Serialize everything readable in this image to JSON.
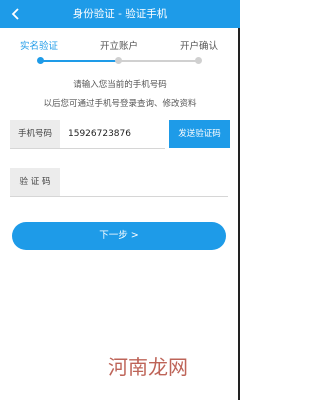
{
  "titlebar": {
    "title": "身份验证 - 验证手机",
    "back_icon": "chevron-left-icon"
  },
  "steps": {
    "items": [
      {
        "label": "实名验证",
        "state": "active"
      },
      {
        "label": "开立账户",
        "state": "pending"
      },
      {
        "label": "开户确认",
        "state": "pending"
      }
    ]
  },
  "intro": {
    "line1": "请输入您当前的手机号码",
    "line2": "以后您可通过手机号登录查询、修改资料"
  },
  "phone": {
    "label": "手机号码",
    "value": "15926723876"
  },
  "sms_button": "发送验证码",
  "code": {
    "label": "验 证 码",
    "value": ""
  },
  "next_button": "下一步 >",
  "watermark": "河南龙网",
  "colors": {
    "accent": "#1e9be8",
    "inactive": "#d0d0d0"
  }
}
